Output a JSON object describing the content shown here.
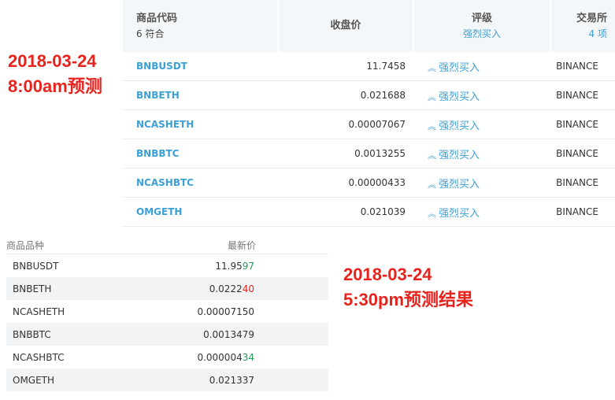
{
  "screener": {
    "header": {
      "symbol_label": "商品代码",
      "match_count": "6 符合",
      "close_label": "收盘价",
      "rating_label": "评级",
      "rating_filter": "强烈买入",
      "exchange_label": "交易所",
      "exchange_count": "4 项"
    },
    "rows": [
      {
        "symbol": "BNBUSDT",
        "close": "11.7458",
        "rating": "强烈买入",
        "exchange": "BINANCE"
      },
      {
        "symbol": "BNBETH",
        "close": "0.021688",
        "rating": "强烈买入",
        "exchange": "BINANCE"
      },
      {
        "symbol": "NCASHETH",
        "close": "0.00007067",
        "rating": "强烈买入",
        "exchange": "BINANCE"
      },
      {
        "symbol": "BNBBTC",
        "close": "0.0013255",
        "rating": "强烈买入",
        "exchange": "BINANCE"
      },
      {
        "symbol": "NCASHBTC",
        "close": "0.00000433",
        "rating": "强烈买入",
        "exchange": "BINANCE"
      },
      {
        "symbol": "OMGETH",
        "close": "0.021039",
        "rating": "强烈买入",
        "exchange": "BINANCE"
      }
    ]
  },
  "annotation_top": {
    "date": "2018-03-24",
    "label": "8:00am预测"
  },
  "annotation_bottom": {
    "date": "2018-03-24",
    "label": "5:30pm预测结果"
  },
  "price_list": {
    "header": {
      "name_label": "商品品种",
      "last_label": "最新价"
    },
    "rows": [
      {
        "name": "BNBUSDT",
        "price_main": "11.95",
        "price_tail": "97",
        "tail_dir": "up"
      },
      {
        "name": "BNBETH",
        "price_main": "0.0222",
        "price_tail": "40",
        "tail_dir": "down"
      },
      {
        "name": "NCASHETH",
        "price_main": "0.00007150",
        "price_tail": "",
        "tail_dir": "none"
      },
      {
        "name": "BNBBTC",
        "price_main": "0.0013479",
        "price_tail": "",
        "tail_dir": "none"
      },
      {
        "name": "NCASHBTC",
        "price_main": "0.000004",
        "price_tail": "34",
        "tail_dir": "up"
      },
      {
        "name": "OMGETH",
        "price_main": "0.021337",
        "price_tail": "",
        "tail_dir": "none"
      }
    ]
  },
  "colors": {
    "accent_blue": "#3ba0d5",
    "annotation_red": "#e8231d",
    "price_up": "#1f9e52",
    "price_down": "#e8231d"
  }
}
